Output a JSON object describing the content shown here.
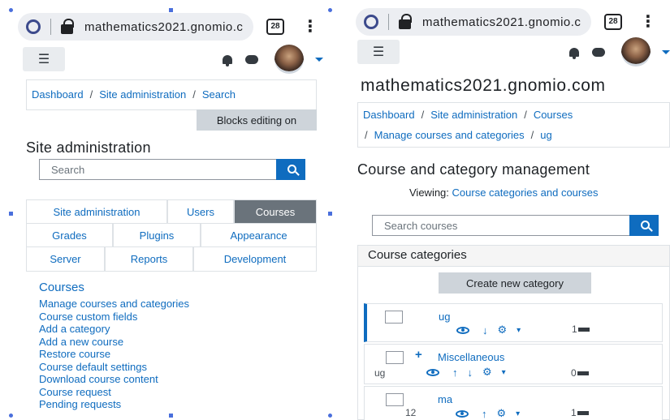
{
  "left": {
    "browser": {
      "url": "mathematics2021.gnomio.c",
      "tab_count": "28"
    },
    "breadcrumb": [
      "Dashboard",
      "Site administration",
      "Search"
    ],
    "breadcrumb_sep": "/",
    "blocks_button": "Blocks editing on",
    "heading": "Site administration",
    "search_placeholder": "Search",
    "tabs": [
      [
        "Site administration",
        "Users",
        "Courses"
      ],
      [
        "Grades",
        "Plugins",
        "Appearance"
      ],
      [
        "Server",
        "Reports",
        "Development"
      ]
    ],
    "active_tab": "Courses",
    "section_title": "Courses",
    "links": [
      "Manage courses and categories",
      "Course custom fields",
      "Add a category",
      "Add a new course",
      "Restore course",
      "Course default settings",
      "Download course content",
      "Course request",
      "Pending requests"
    ]
  },
  "right": {
    "browser": {
      "url": "mathematics2021.gnomio.c",
      "tab_count": "28"
    },
    "site_title": "mathematics2021.gnomio.com",
    "breadcrumb_line1": [
      "Dashboard",
      "Site administration",
      "Courses"
    ],
    "breadcrumb_line2": [
      "Manage courses and categories",
      "ug"
    ],
    "breadcrumb_sep": "/",
    "heading": "Course and category management",
    "viewing_label": "Viewing:",
    "viewing_value": "Course categories and courses",
    "search_placeholder": "Search courses",
    "categories_title": "Course categories",
    "create_button": "Create new category",
    "categories": [
      {
        "name": "ug",
        "parent": "",
        "count": "1",
        "active": true
      },
      {
        "name": "Miscellaneous",
        "parent": "ug",
        "count": "0",
        "active": false
      },
      {
        "name": "ma",
        "parent": "12",
        "count": "1",
        "active": false
      }
    ]
  },
  "colors": {
    "link": "#0f6cbf",
    "active_tab": "#6a737b",
    "button": "#ced4da"
  }
}
